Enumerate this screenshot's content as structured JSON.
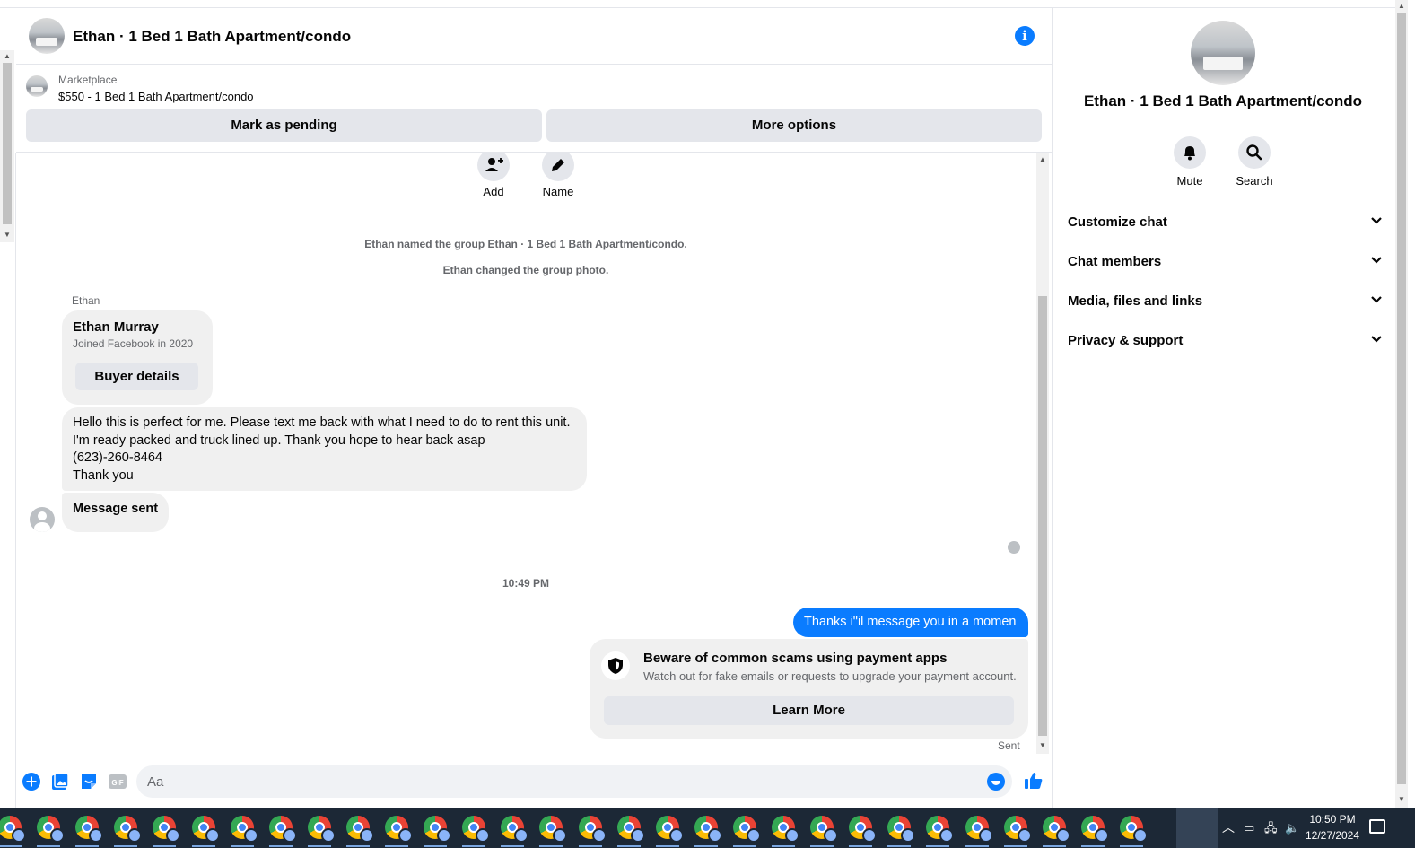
{
  "header": {
    "title": "Ethan · 1 Bed 1 Bath Apartment/condo",
    "info_icon": "info-icon"
  },
  "marketplace": {
    "label": "Marketplace",
    "listing": "$550 - 1 Bed 1 Bath Apartment/condo",
    "pending_button": "Mark as pending",
    "more_button": "More options"
  },
  "group_actions": {
    "add_label": "Add",
    "name_label": "Name"
  },
  "system_messages": [
    "Ethan named the group Ethan · 1 Bed 1 Bath Apartment/condo.",
    "Ethan changed the group photo."
  ],
  "messages": {
    "sender": "Ethan",
    "profile_card": {
      "name": "Ethan Murray",
      "joined": "Joined Facebook in 2020",
      "button": "Buyer details"
    },
    "long_text": "Hello this is perfect for me. Please text me back with what I need to do to rent this unit. I'm ready packed and truck lined up. Thank you hope to hear back asap\n(623)-260-8464\n Thank you",
    "message_sent": "Message sent",
    "timestamp": "10:49 PM",
    "outgoing": "Thanks i\"il message you in a momen",
    "scam_title": "Beware of common scams using payment apps",
    "scam_sub": "Watch out for fake emails or requests to upgrade your payment account.",
    "scam_button": "Learn More",
    "status": "Sent"
  },
  "composer": {
    "placeholder": "Aa",
    "value": ""
  },
  "right_panel": {
    "title": "Ethan · 1 Bed 1 Bath Apartment/condo",
    "mute_label": "Mute",
    "search_label": "Search",
    "sections": [
      "Customize chat",
      "Chat members",
      "Media, files and links",
      "Privacy & support"
    ]
  },
  "taskbar": {
    "time": "10:50 PM",
    "date": "12/27/2024",
    "app_count": 30
  },
  "colors": {
    "accent": "#0a7cff",
    "bubble_gray": "#f0f0f0",
    "button_gray": "#e4e6eb",
    "taskbar": "#1c2836"
  }
}
